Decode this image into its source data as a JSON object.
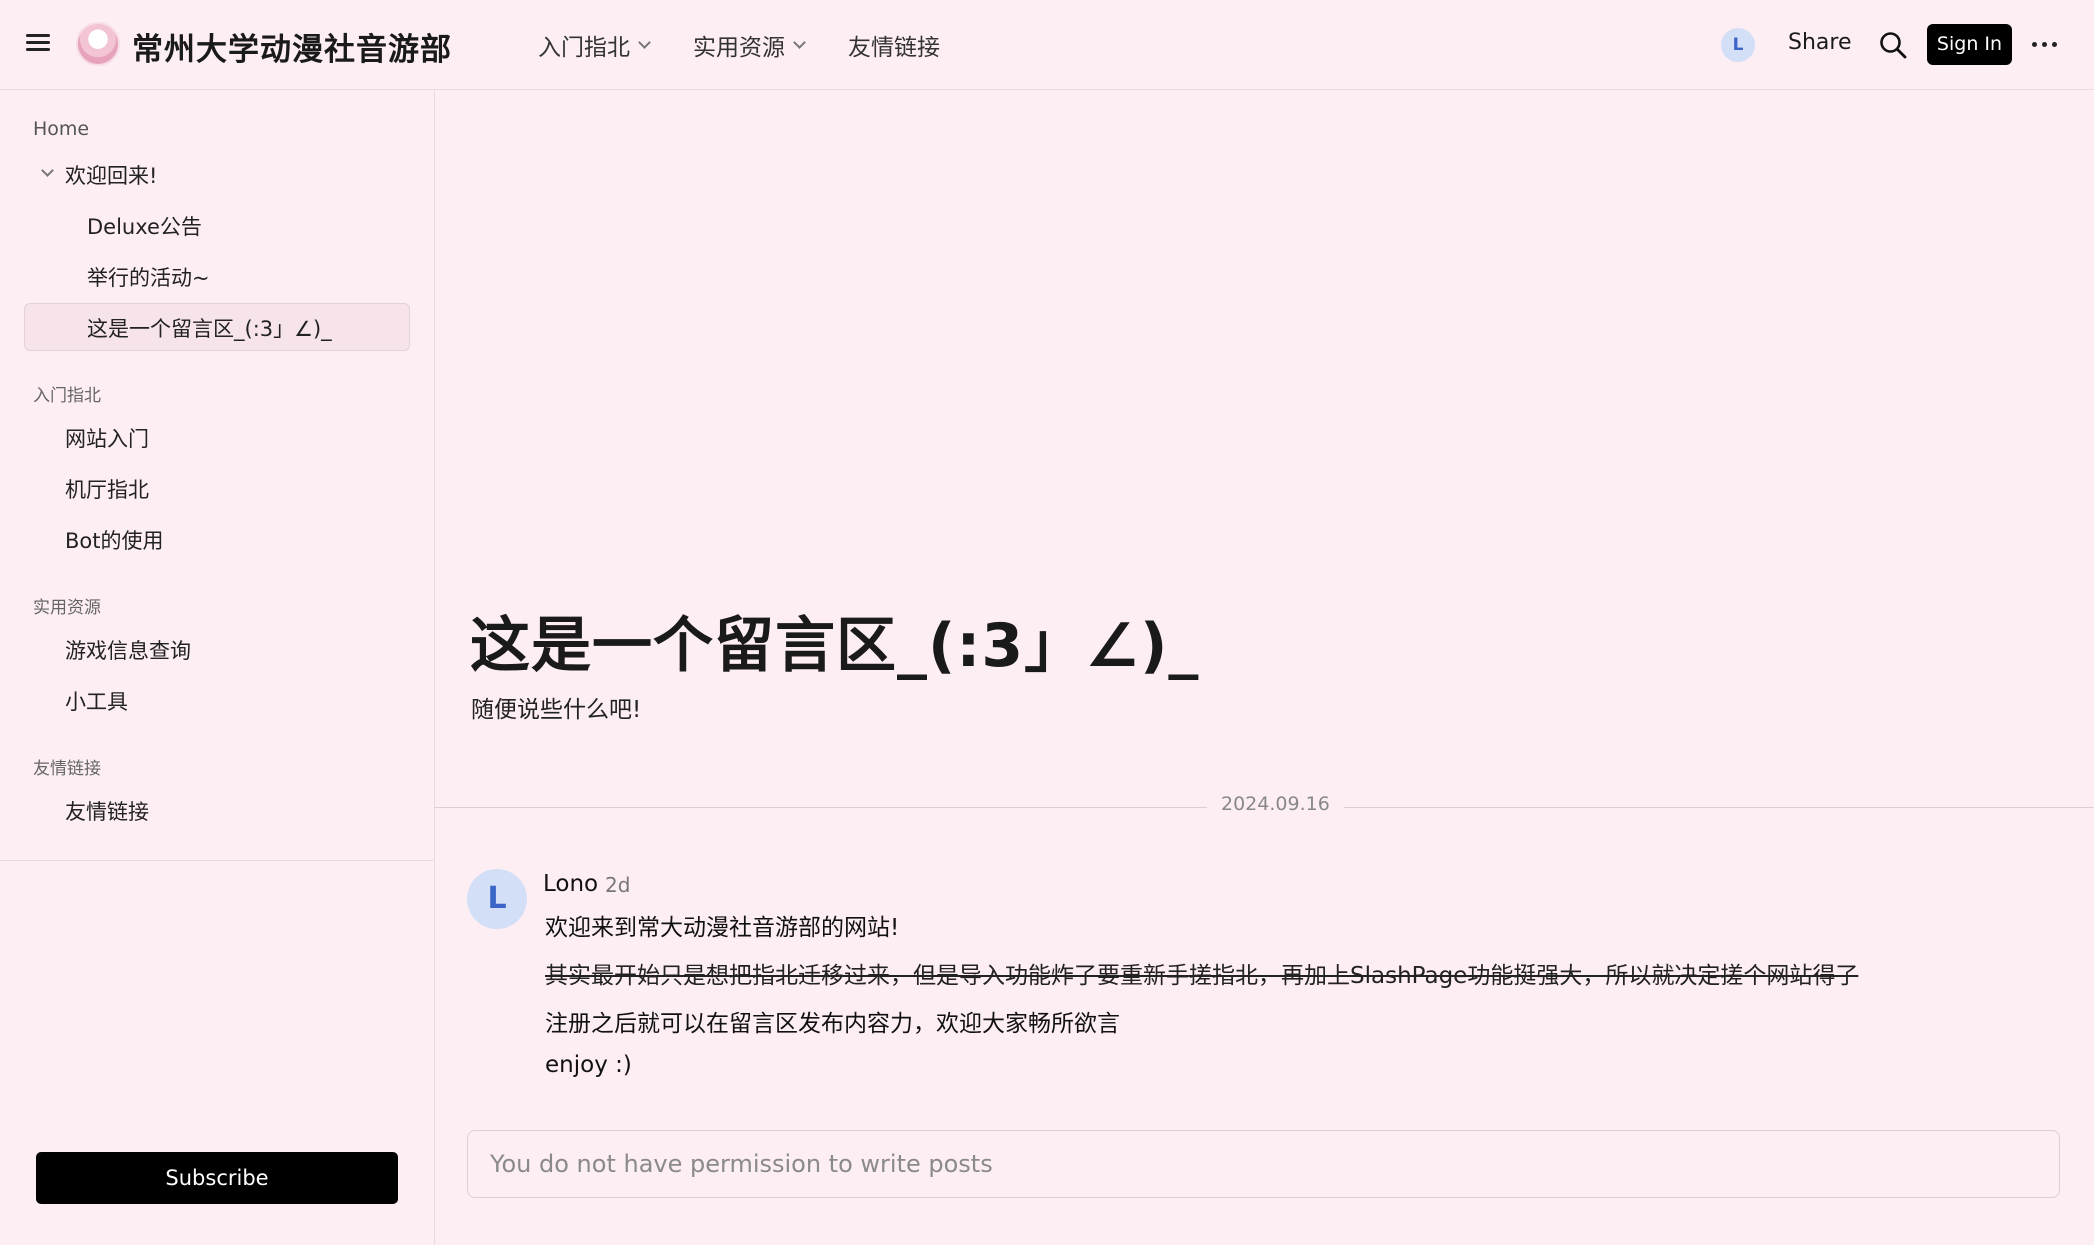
{
  "header": {
    "site_title": "常州大学动漫社音游部",
    "nav": [
      {
        "label": "入门指北",
        "has_dropdown": true
      },
      {
        "label": "实用资源",
        "has_dropdown": true
      },
      {
        "label": "友情链接",
        "has_dropdown": false
      }
    ],
    "user_initial": "L",
    "share_label": "Share",
    "signin_label": "Sign In"
  },
  "sidebar": {
    "home_label": "Home",
    "welcome_group": {
      "label": "欢迎回来!",
      "expanded": true,
      "children": [
        "Deluxe公告",
        "举行的活动~",
        "这是一个留言区_(:3」∠)_"
      ],
      "active_index": 2
    },
    "sections": [
      {
        "title": "入门指北",
        "items": [
          "网站入门",
          "机厅指北",
          "Bot的使用"
        ]
      },
      {
        "title": "实用资源",
        "items": [
          "游戏信息查询",
          "小工具"
        ]
      },
      {
        "title": "友情链接",
        "items": [
          "友情链接"
        ]
      }
    ],
    "subscribe_label": "Subscribe"
  },
  "main": {
    "title": "这是一个留言区_(:3」∠)_",
    "subtitle": "随便说些什么吧!",
    "date_divider": "2024.09.16",
    "post": {
      "avatar_initial": "L",
      "author": "Lono",
      "time": "2d",
      "lines": [
        "欢迎来到常大动漫社音游部的网站!",
        "其实最开始只是想把指北迁移过来，但是导入功能炸了要重新手搓指北，再加上SlashPage功能挺强大，所以就决定搓个网站得了",
        "注册之后就可以在留言区发布内容力，欢迎大家畅所欲言",
        "enjoy :)"
      ],
      "strikethrough_line_index": 1
    },
    "compose_placeholder": "You do not have permission to write posts"
  },
  "colors": {
    "background": "#fdeef3",
    "avatar_bg": "#d3def7",
    "avatar_fg": "#3a64c8",
    "button_bg": "#000000"
  }
}
